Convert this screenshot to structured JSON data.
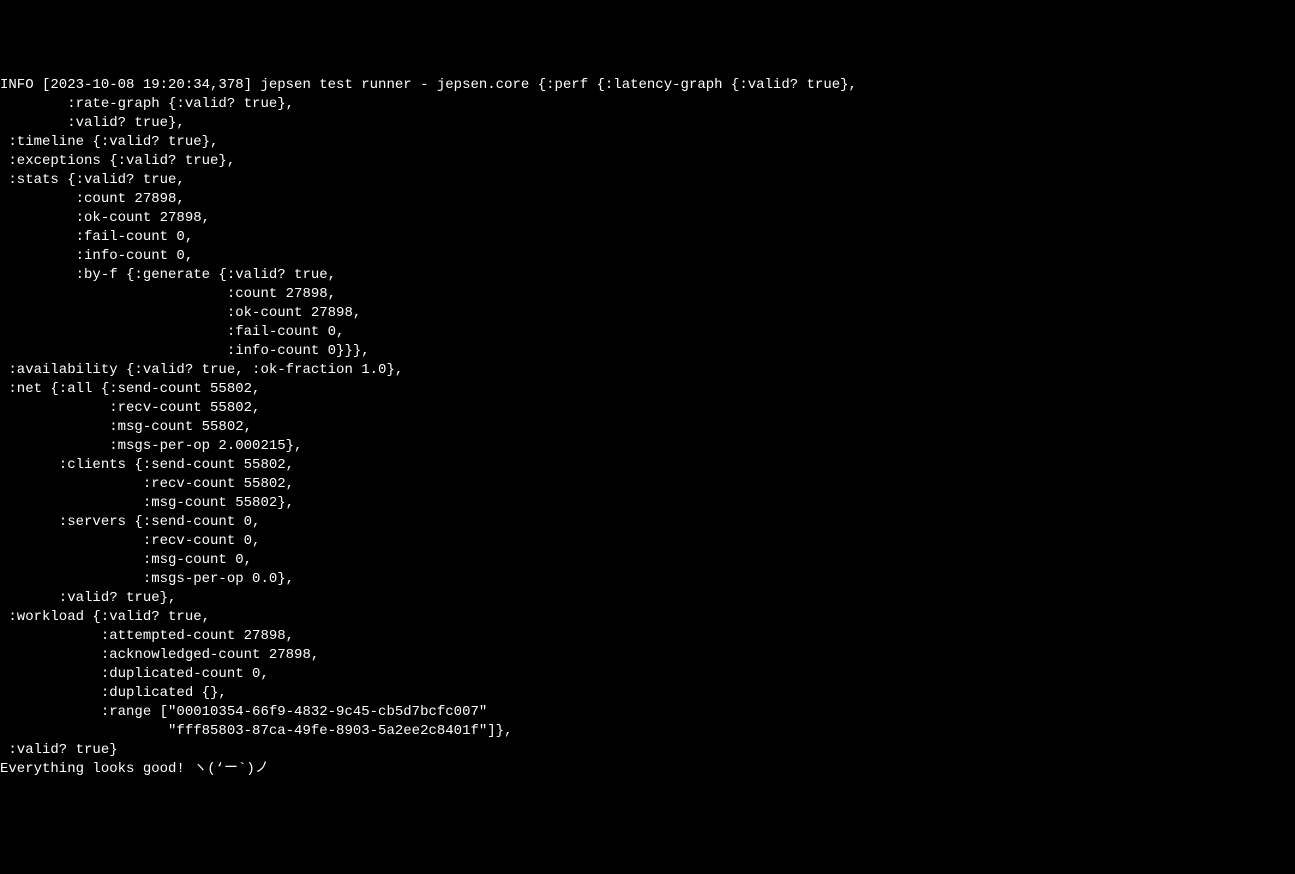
{
  "terminal": {
    "lines": [
      "INFO [2023-10-08 19:20:34,378] jepsen test runner - jepsen.core {:perf {:latency-graph {:valid? true},",
      "        :rate-graph {:valid? true},",
      "        :valid? true},",
      " :timeline {:valid? true},",
      " :exceptions {:valid? true},",
      " :stats {:valid? true,",
      "         :count 27898,",
      "         :ok-count 27898,",
      "         :fail-count 0,",
      "         :info-count 0,",
      "         :by-f {:generate {:valid? true,",
      "                           :count 27898,",
      "                           :ok-count 27898,",
      "                           :fail-count 0,",
      "                           :info-count 0}}},",
      " :availability {:valid? true, :ok-fraction 1.0},",
      " :net {:all {:send-count 55802,",
      "             :recv-count 55802,",
      "             :msg-count 55802,",
      "             :msgs-per-op 2.000215},",
      "       :clients {:send-count 55802,",
      "                 :recv-count 55802,",
      "                 :msg-count 55802},",
      "       :servers {:send-count 0,",
      "                 :recv-count 0,",
      "                 :msg-count 0,",
      "                 :msgs-per-op 0.0},",
      "       :valid? true},",
      " :workload {:valid? true,",
      "            :attempted-count 27898,",
      "            :acknowledged-count 27898,",
      "            :duplicated-count 0,",
      "            :duplicated {},",
      "            :range [\"00010354-66f9-4832-9c45-cb5d7bcfc007\"",
      "                    \"fff85803-87ca-49fe-8903-5a2ee2c8401f\"]},",
      " :valid? true}",
      "",
      "",
      "Everything looks good! ヽ(‘ー`)ノ"
    ]
  }
}
